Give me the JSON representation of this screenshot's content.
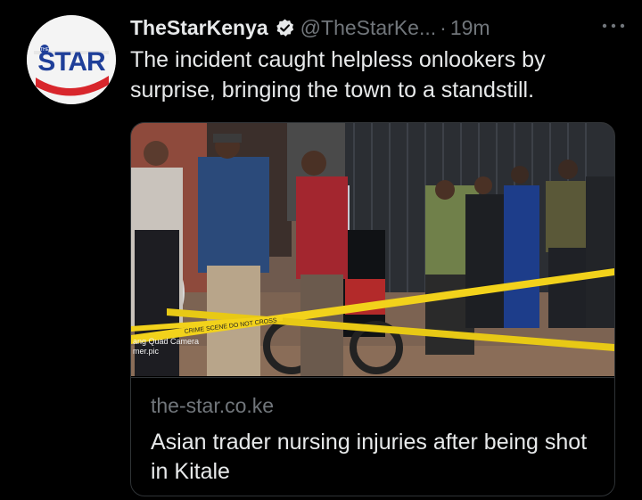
{
  "tweet": {
    "avatar_text": "STAR",
    "display_name": "TheStarKenya",
    "handle": "@TheStarKe...",
    "separator": "·",
    "time": "19m",
    "text": "The incident caught helpless onlookers by surprise, bringing the town to a standstill."
  },
  "card": {
    "domain": "the-star.co.ke",
    "title": "Asian trader nursing injuries after being shot in Kitale",
    "watermark_line1": "ang Quad Camera",
    "watermark_line2": "mer.pic",
    "tape_text": "CRIME SCENE DO NOT CROSS"
  },
  "colors": {
    "background": "#000000",
    "primary_text": "#e7e9ea",
    "secondary_text": "#71767b",
    "border": "#2f3336",
    "brand_blue": "#1f3f99",
    "brand_red": "#d8262c",
    "tape_yellow": "#f2d21b"
  },
  "icons": {
    "verified": "verified-badge-icon",
    "more": "more-horizontal-icon"
  }
}
